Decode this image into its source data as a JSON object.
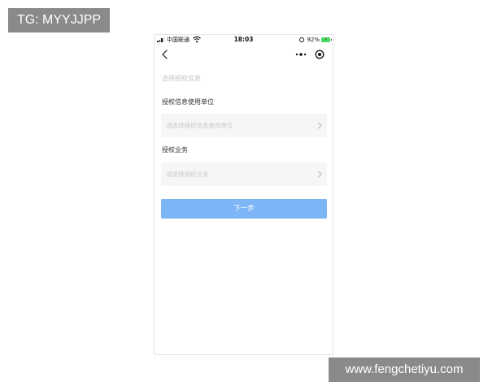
{
  "watermarks": {
    "top": "TG: MYYJJPP",
    "bottom": "www.fengchetiyu.com"
  },
  "status_bar": {
    "carrier": "中国联通",
    "time": "18:03",
    "battery_percent": "92%",
    "battery_color": "#4cd964"
  },
  "nav": {
    "back_icon": "chevron-left-icon",
    "more_icon": "more-dots-icon",
    "close_icon": "target-icon"
  },
  "form": {
    "section_hint": "选择授权信息",
    "unit": {
      "label": "授权信息使用单位",
      "placeholder": "请选择授权信息使用单位"
    },
    "business": {
      "label": "授权业务",
      "placeholder": "请选择授权业务"
    }
  },
  "actions": {
    "next_label": "下一步",
    "next_color": "#7db5f7"
  }
}
